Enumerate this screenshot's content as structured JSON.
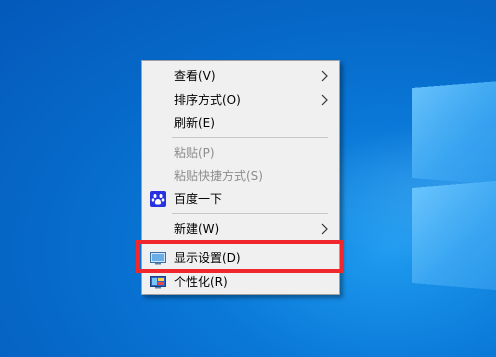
{
  "context_menu": {
    "items": [
      {
        "label": "查看(V)",
        "submenu": true,
        "enabled": true
      },
      {
        "label": "排序方式(O)",
        "submenu": true,
        "enabled": true
      },
      {
        "label": "刷新(E)",
        "submenu": false,
        "enabled": true
      },
      {
        "label": "粘贴(P)",
        "submenu": false,
        "enabled": false
      },
      {
        "label": "粘贴快捷方式(S)",
        "submenu": false,
        "enabled": false
      },
      {
        "label": "百度一下",
        "submenu": false,
        "enabled": true,
        "icon": "baidu-paw-icon"
      },
      {
        "label": "新建(W)",
        "submenu": true,
        "enabled": true
      },
      {
        "label": "显示设置(D)",
        "submenu": false,
        "enabled": true,
        "icon": "display-settings-icon",
        "highlighted": true
      },
      {
        "label": "个性化(R)",
        "submenu": false,
        "enabled": true,
        "icon": "personalize-icon"
      }
    ]
  },
  "colors": {
    "desktop_blue": "#0a78d7",
    "menu_bg": "#f0f0f0",
    "highlight_red": "#f0282d",
    "baidu_blue": "#2932e1"
  }
}
